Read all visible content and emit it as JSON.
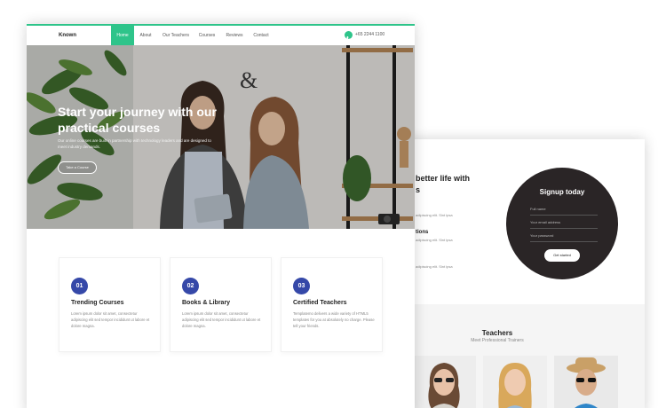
{
  "colors": {
    "accent": "#2ec48a",
    "number_badge": "#3548a8",
    "signup_bg": "#2a2526"
  },
  "nav": {
    "brand": "Known",
    "items": [
      {
        "label": "Home",
        "active": true
      },
      {
        "label": "About",
        "active": false
      },
      {
        "label": "Our Teachers",
        "active": false
      },
      {
        "label": "Courses",
        "active": false
      },
      {
        "label": "Reviews",
        "active": false
      },
      {
        "label": "Contact",
        "active": false
      }
    ],
    "phone_icon": "phone-icon",
    "phone": "+65 2244 1100"
  },
  "hero": {
    "title": "Start your journey with our practical courses",
    "description": "Our online courses are built in partnership with technology leaders and are designed to meet industry demands.",
    "button": "Take a Course"
  },
  "features": [
    {
      "number": "01",
      "title": "Trending Courses",
      "text": "Lorem ipsum dolor sit amet, consectetur adipiscing elit sed tempor incididunt ut labore et dolore magna."
    },
    {
      "number": "02",
      "title": "Books & Library",
      "text": "Lorem ipsum dolor sit amet, consectetur adipiscing elit sed tempor incididunt ut labore et dolore magna."
    },
    {
      "number": "03",
      "title": "Certified Teachers",
      "text": "Templatemo delivers a wide variety of HTML5 templates for you at absolutely no charge. Please tell your friends."
    }
  ],
  "back": {
    "heading": "better life with",
    "heading_line2": "s",
    "feature1_text": "adipiscing elit. Sint ipsa",
    "feature2_title": "tions",
    "feature2_text": "adipiscing elit. Sint ipsa",
    "feature3_text": "adipiscing elit. Sint ipsa",
    "signup": {
      "title": "Signup today",
      "full_name": "Full name",
      "email": "Your email address",
      "password": "Your password",
      "button": "Get started"
    },
    "teachers": {
      "title": "Teachers",
      "subtitle": "Meet Professional Trainers"
    }
  }
}
